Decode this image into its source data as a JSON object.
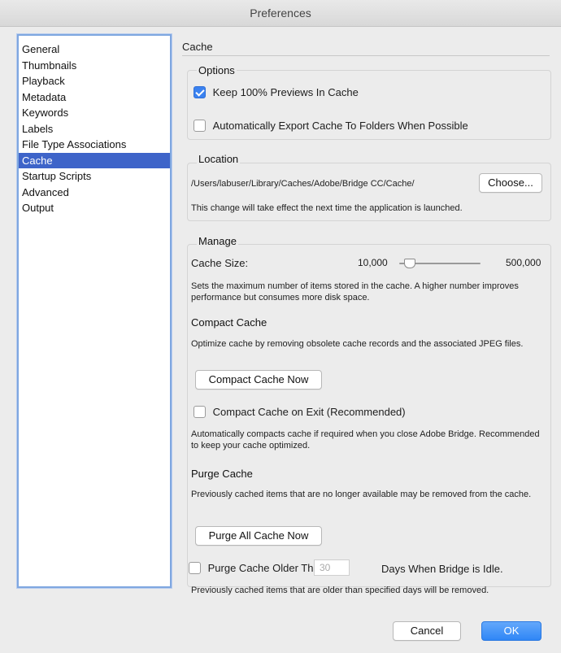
{
  "window": {
    "title": "Preferences"
  },
  "sidebar": {
    "items": [
      {
        "label": "General"
      },
      {
        "label": "Thumbnails"
      },
      {
        "label": "Playback"
      },
      {
        "label": "Metadata"
      },
      {
        "label": "Keywords"
      },
      {
        "label": "Labels"
      },
      {
        "label": "File Type Associations"
      },
      {
        "label": "Cache"
      },
      {
        "label": "Startup Scripts"
      },
      {
        "label": "Advanced"
      },
      {
        "label": "Output"
      }
    ],
    "selected": "Cache"
  },
  "cache": {
    "title": "Cache",
    "options": {
      "heading": "Options",
      "keep_previews": {
        "label": "Keep 100% Previews In Cache",
        "checked": true
      },
      "auto_export": {
        "label": "Automatically Export Cache To Folders When Possible",
        "checked": false
      }
    },
    "location": {
      "heading": "Location",
      "path": "/Users/labuser/Library/Caches/Adobe/Bridge CC/Cache/",
      "choose_label": "Choose...",
      "note": "This change will take effect the next time the application is launched."
    },
    "manage": {
      "heading": "Manage",
      "cache_size_label": "Cache Size:",
      "cache_size_min": "10,000",
      "cache_size_max": "500,000",
      "cache_size_fraction": 0.12,
      "cache_size_desc": "Sets the maximum number of items stored in the cache. A higher number improves performance but consumes more disk space.",
      "compact_heading": "Compact Cache",
      "compact_desc": "Optimize cache by removing obsolete cache records and the associated JPEG files.",
      "compact_now_label": "Compact Cache Now",
      "compact_on_exit": {
        "label": "Compact Cache on Exit (Recommended)",
        "checked": false
      },
      "compact_on_exit_desc": "Automatically compacts cache if required when you close Adobe Bridge. Recommended to keep your cache optimized.",
      "purge_heading": "Purge Cache",
      "purge_desc": "Previously cached items that are no longer available may be removed from the cache.",
      "purge_now_label": "Purge All Cache Now",
      "purge_older": {
        "label": "Purge Cache Older Than",
        "days_placeholder": "30",
        "suffix": "Days When Bridge is Idle.",
        "checked": false
      },
      "purge_older_desc": "Previously cached items that are older than specified days will be removed."
    }
  },
  "footer": {
    "cancel_label": "Cancel",
    "ok_label": "OK"
  },
  "colors": {
    "accent": "#3b82f0",
    "selection": "#3e64c9"
  }
}
